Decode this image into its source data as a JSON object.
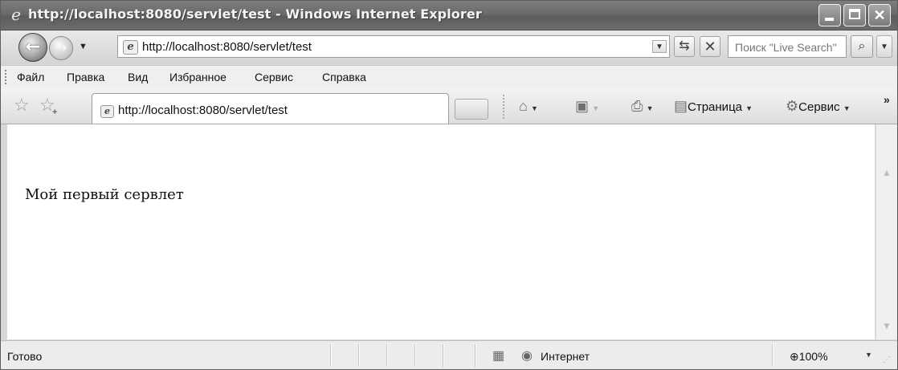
{
  "window": {
    "title": "http://localhost:8080/servlet/test - Windows Internet Explorer",
    "title_icon": "ie-logo-icon"
  },
  "nav": {
    "address": "http://localhost:8080/servlet/test",
    "search_placeholder": "Поиск \"Live Search\""
  },
  "menu": {
    "items": [
      {
        "label": "Файл"
      },
      {
        "label": "Правка"
      },
      {
        "label": "Вид"
      },
      {
        "label": "Избранное"
      },
      {
        "label": "Сервис"
      },
      {
        "label": "Справка"
      }
    ]
  },
  "tab": {
    "title": "http://localhost:8080/servlet/test"
  },
  "commands": {
    "page": "Страница",
    "tools": "Сервис"
  },
  "page": {
    "text": "Мой первый сервлет"
  },
  "status": {
    "text": "Готово",
    "zone": "Интернет",
    "zoom": "100%"
  },
  "icons": {
    "back": "back-arrow-icon",
    "forward": "forward-arrow-icon",
    "refresh": "refresh-icon",
    "stop": "stop-icon",
    "search": "search-icon",
    "favorites": "favorites-star-icon",
    "add_favorites": "add-favorites-icon",
    "home": "home-icon",
    "feeds": "rss-feed-icon",
    "print": "print-icon",
    "page": "page-icon",
    "tools": "gear-icon",
    "globe": "globe-icon",
    "zoom": "zoom-icon"
  }
}
